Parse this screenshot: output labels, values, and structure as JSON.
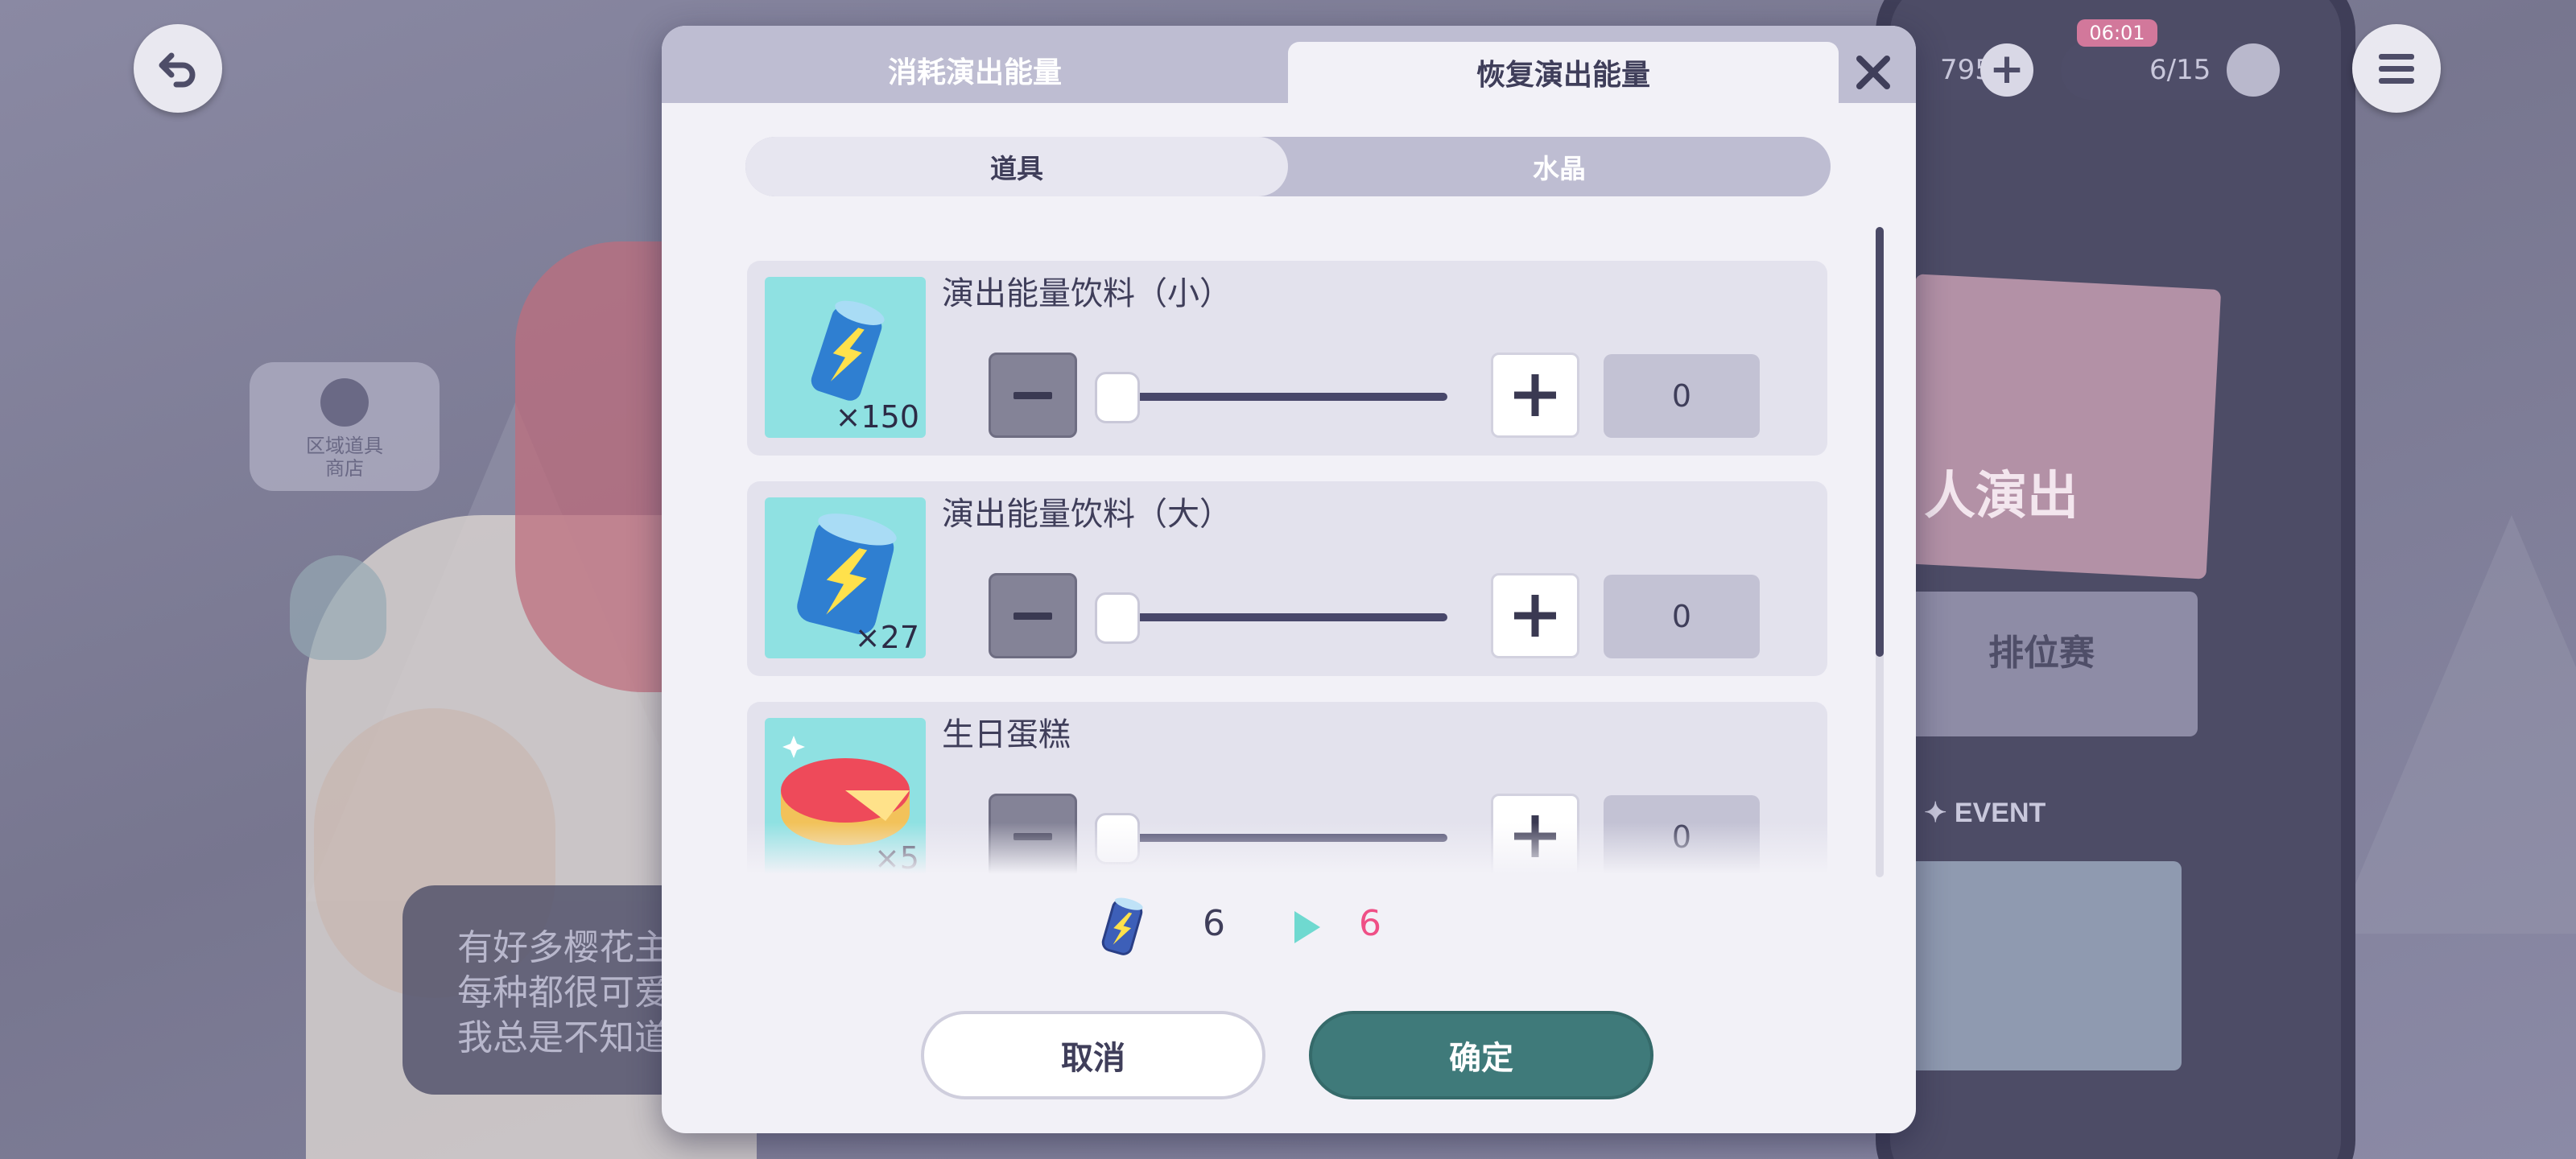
{
  "background": {
    "coin_count": "795",
    "energy_display": "6/15",
    "timer": "06:01",
    "shop_badge_label": "区域道具\n商店",
    "phone_title": "人演出",
    "rank_match": "排位赛",
    "event_label": "✦ EVENT",
    "speech_text": "有好多樱花主\n每种都很可爱\n我总是不知道"
  },
  "dialog": {
    "tabs": {
      "consume": "消耗演出能量",
      "recover": "恢复演出能量"
    },
    "segments": {
      "items": "道具",
      "crystal": "水晶"
    },
    "items": [
      {
        "name": "演出能量饮料（小）",
        "count": "×150",
        "quantity": "0",
        "slider_value": 0
      },
      {
        "name": "演出能量饮料（大）",
        "count": "×27",
        "quantity": "0",
        "slider_value": 0
      },
      {
        "name": "生日蛋糕",
        "count": "×5",
        "quantity": "0",
        "slider_value": 0
      }
    ],
    "energy": {
      "current": "6",
      "after": "6"
    },
    "buttons": {
      "cancel": "取消",
      "confirm": "确定"
    }
  },
  "colors": {
    "accent_teal": "#3f7a7a",
    "highlight_pink": "#ef4f86",
    "thumb_cyan": "#8fe1e2"
  },
  "icons": [
    "back-arrow-icon",
    "menu-icon",
    "close-icon",
    "minus-icon",
    "plus-icon",
    "energy-can-icon",
    "play-arrow-icon",
    "gear-icon",
    "birthday-cake-icon"
  ]
}
